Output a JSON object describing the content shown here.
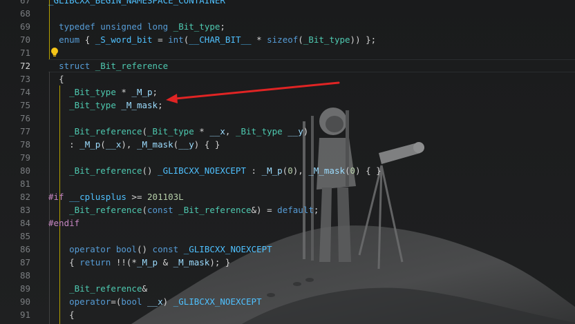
{
  "colors": {
    "background": "#1b1c1d",
    "keyword": "#569cd6",
    "type": "#4ec9b0",
    "identifier": "#9cdcfe",
    "macro": "#4fc1ff",
    "number": "#b5cea8",
    "preprocessor": "#c586c0",
    "punctuation": "#d4d4d4",
    "line_number": "#7a7d80",
    "active_line_number": "#d4d4d4",
    "annotation_arrow": "#e02424",
    "lightbulb": "#f5c518"
  },
  "icons": {
    "lightbulb": "lightbulb-icon",
    "annotation": "red-arrow-annotation",
    "wallpaper": "astronaut-with-telescope-background"
  },
  "editor": {
    "active_line": "72",
    "lines": [
      {
        "num": "67",
        "tokens": [
          {
            "t": "_GLIBCXX_BEGIN_NAMESPACE_CONTAINER",
            "c": "mac"
          }
        ]
      },
      {
        "num": "68",
        "tokens": []
      },
      {
        "num": "69",
        "tokens": [
          {
            "t": "  "
          },
          {
            "t": "typedef",
            "c": "kw"
          },
          {
            "t": " "
          },
          {
            "t": "unsigned",
            "c": "kw"
          },
          {
            "t": " "
          },
          {
            "t": "long",
            "c": "kw"
          },
          {
            "t": " "
          },
          {
            "t": "_Bit_type",
            "c": "ty"
          },
          {
            "t": ";",
            "c": "pn"
          }
        ]
      },
      {
        "num": "70",
        "tokens": [
          {
            "t": "  "
          },
          {
            "t": "enum",
            "c": "kw"
          },
          {
            "t": " { ",
            "c": "pn"
          },
          {
            "t": "_S_word_bit",
            "c": "mac"
          },
          {
            "t": " = ",
            "c": "pn"
          },
          {
            "t": "int",
            "c": "kw"
          },
          {
            "t": "(",
            "c": "pn"
          },
          {
            "t": "__CHAR_BIT__",
            "c": "mac"
          },
          {
            "t": " * ",
            "c": "pn"
          },
          {
            "t": "sizeof",
            "c": "kw"
          },
          {
            "t": "(",
            "c": "pn"
          },
          {
            "t": "_Bit_type",
            "c": "ty"
          },
          {
            "t": ")) };",
            "c": "pn"
          }
        ]
      },
      {
        "num": "71",
        "tokens": []
      },
      {
        "num": "72",
        "tokens": [
          {
            "t": "  "
          },
          {
            "t": "struct",
            "c": "kw"
          },
          {
            "t": " "
          },
          {
            "t": "_Bit_reference",
            "c": "ty"
          }
        ]
      },
      {
        "num": "73",
        "tokens": [
          {
            "t": "  "
          },
          {
            "t": "{",
            "c": "pn"
          }
        ]
      },
      {
        "num": "74",
        "tokens": [
          {
            "t": "    "
          },
          {
            "t": "_Bit_type",
            "c": "ty"
          },
          {
            "t": " * ",
            "c": "pn"
          },
          {
            "t": "_M_p",
            "c": "id"
          },
          {
            "t": ";",
            "c": "pn"
          }
        ]
      },
      {
        "num": "75",
        "tokens": [
          {
            "t": "    "
          },
          {
            "t": "_Bit_type",
            "c": "ty"
          },
          {
            "t": " "
          },
          {
            "t": "_M_mask",
            "c": "id"
          },
          {
            "t": ";",
            "c": "pn"
          }
        ]
      },
      {
        "num": "76",
        "tokens": []
      },
      {
        "num": "77",
        "tokens": [
          {
            "t": "    "
          },
          {
            "t": "_Bit_reference",
            "c": "ty"
          },
          {
            "t": "(",
            "c": "pn"
          },
          {
            "t": "_Bit_type",
            "c": "ty"
          },
          {
            "t": " * ",
            "c": "pn"
          },
          {
            "t": "__x",
            "c": "id"
          },
          {
            "t": ", ",
            "c": "pn"
          },
          {
            "t": "_Bit_type",
            "c": "ty"
          },
          {
            "t": " "
          },
          {
            "t": "__y",
            "c": "id"
          },
          {
            "t": ")",
            "c": "pn"
          }
        ]
      },
      {
        "num": "78",
        "tokens": [
          {
            "t": "    "
          },
          {
            "t": ": ",
            "c": "pn"
          },
          {
            "t": "_M_p",
            "c": "id"
          },
          {
            "t": "(",
            "c": "pn"
          },
          {
            "t": "__x",
            "c": "id"
          },
          {
            "t": "), ",
            "c": "pn"
          },
          {
            "t": "_M_mask",
            "c": "id"
          },
          {
            "t": "(",
            "c": "pn"
          },
          {
            "t": "__y",
            "c": "id"
          },
          {
            "t": ") { }",
            "c": "pn"
          }
        ]
      },
      {
        "num": "79",
        "tokens": []
      },
      {
        "num": "80",
        "tokens": [
          {
            "t": "    "
          },
          {
            "t": "_Bit_reference",
            "c": "ty"
          },
          {
            "t": "() ",
            "c": "pn"
          },
          {
            "t": "_GLIBCXX_NOEXCEPT",
            "c": "mac"
          },
          {
            "t": " : ",
            "c": "pn"
          },
          {
            "t": "_M_p",
            "c": "id"
          },
          {
            "t": "(",
            "c": "pn"
          },
          {
            "t": "0",
            "c": "num"
          },
          {
            "t": "), ",
            "c": "pn"
          },
          {
            "t": "_M_mask",
            "c": "id"
          },
          {
            "t": "(",
            "c": "pn"
          },
          {
            "t": "0",
            "c": "num"
          },
          {
            "t": ") { }",
            "c": "pn"
          }
        ]
      },
      {
        "num": "81",
        "tokens": []
      },
      {
        "num": "82",
        "tokens": [
          {
            "t": "#if",
            "c": "pp"
          },
          {
            "t": " "
          },
          {
            "t": "__cplusplus",
            "c": "mac"
          },
          {
            "t": " >= ",
            "c": "pn"
          },
          {
            "t": "201103L",
            "c": "num"
          }
        ]
      },
      {
        "num": "83",
        "tokens": [
          {
            "t": "    "
          },
          {
            "t": "_Bit_reference",
            "c": "ty"
          },
          {
            "t": "(",
            "c": "pn"
          },
          {
            "t": "const",
            "c": "kw"
          },
          {
            "t": " "
          },
          {
            "t": "_Bit_reference",
            "c": "ty"
          },
          {
            "t": "&) = ",
            "c": "pn"
          },
          {
            "t": "default",
            "c": "kw"
          },
          {
            "t": ";",
            "c": "pn"
          }
        ]
      },
      {
        "num": "84",
        "tokens": [
          {
            "t": "#endif",
            "c": "pp"
          }
        ]
      },
      {
        "num": "85",
        "tokens": []
      },
      {
        "num": "86",
        "tokens": [
          {
            "t": "    "
          },
          {
            "t": "operator",
            "c": "kw"
          },
          {
            "t": " "
          },
          {
            "t": "bool",
            "c": "kw"
          },
          {
            "t": "() ",
            "c": "pn"
          },
          {
            "t": "const",
            "c": "kw"
          },
          {
            "t": " "
          },
          {
            "t": "_GLIBCXX_NOEXCEPT",
            "c": "mac"
          }
        ]
      },
      {
        "num": "87",
        "tokens": [
          {
            "t": "    "
          },
          {
            "t": "{ ",
            "c": "pn"
          },
          {
            "t": "return",
            "c": "kw"
          },
          {
            "t": " !!(*",
            "c": "pn"
          },
          {
            "t": "_M_p",
            "c": "id"
          },
          {
            "t": " & ",
            "c": "pn"
          },
          {
            "t": "_M_mask",
            "c": "id"
          },
          {
            "t": "); }",
            "c": "pn"
          }
        ]
      },
      {
        "num": "88",
        "tokens": []
      },
      {
        "num": "89",
        "tokens": [
          {
            "t": "    "
          },
          {
            "t": "_Bit_reference",
            "c": "ty"
          },
          {
            "t": "&",
            "c": "pn"
          }
        ]
      },
      {
        "num": "90",
        "tokens": [
          {
            "t": "    "
          },
          {
            "t": "operator",
            "c": "kw"
          },
          {
            "t": "=(",
            "c": "pn"
          },
          {
            "t": "bool",
            "c": "kw"
          },
          {
            "t": " "
          },
          {
            "t": "__x",
            "c": "id"
          },
          {
            "t": ") ",
            "c": "pn"
          },
          {
            "t": "_GLIBCXX_NOEXCEPT",
            "c": "mac"
          }
        ]
      },
      {
        "num": "91",
        "tokens": [
          {
            "t": "    "
          },
          {
            "t": "{",
            "c": "pn"
          }
        ]
      }
    ]
  }
}
